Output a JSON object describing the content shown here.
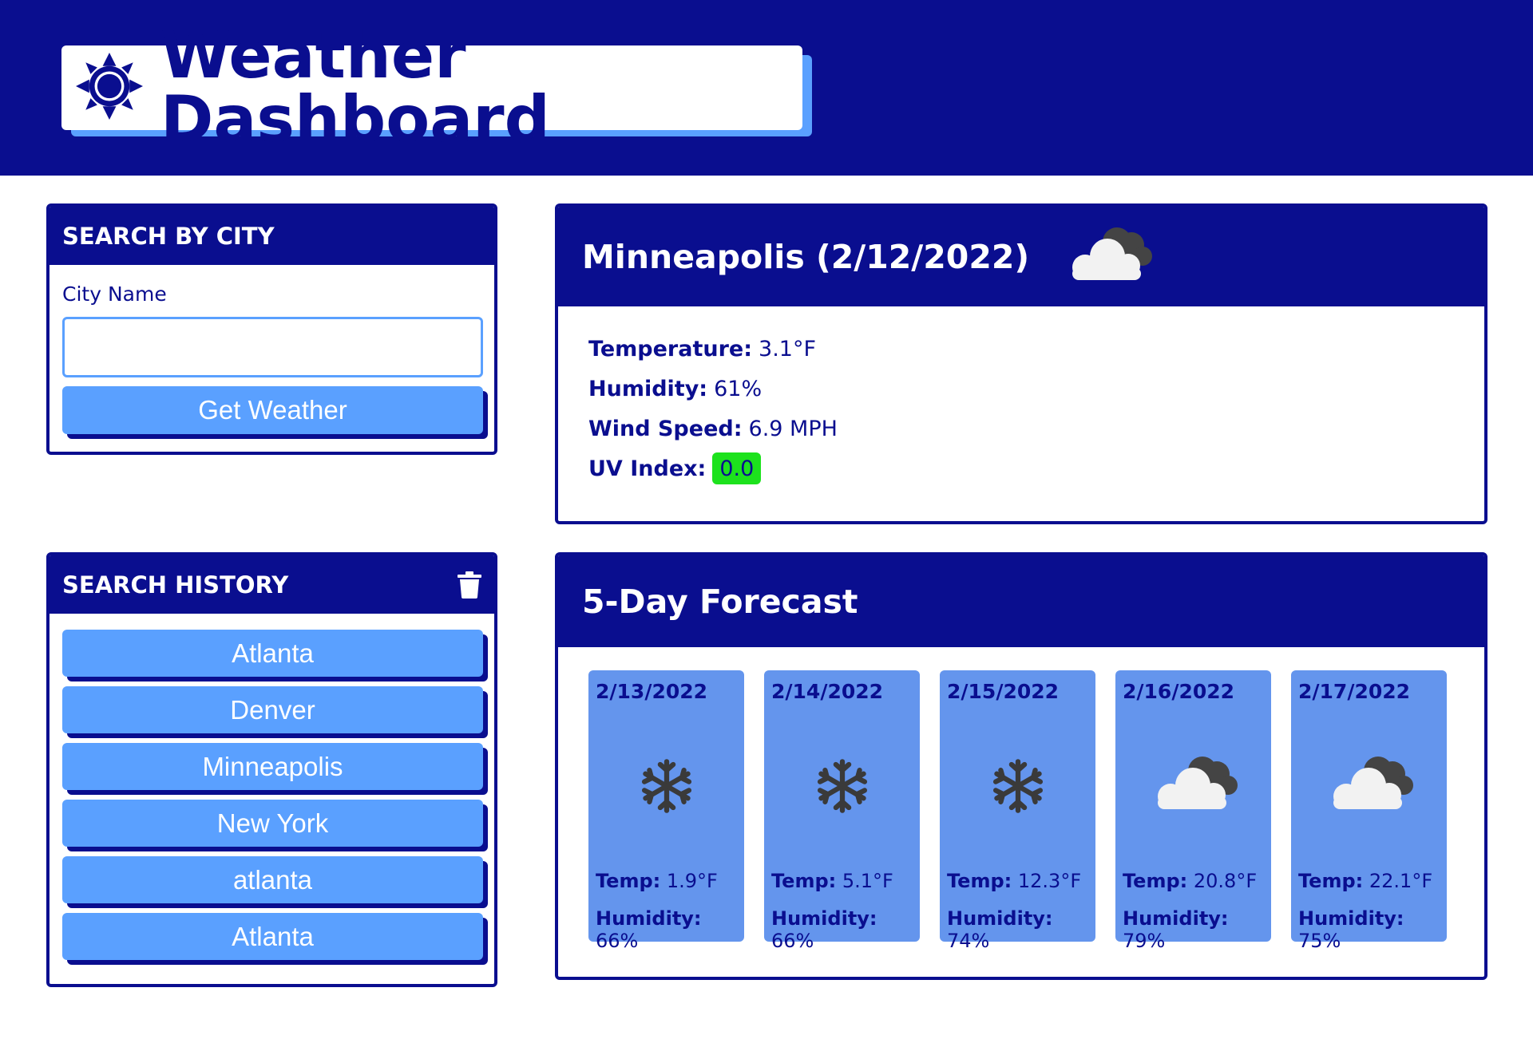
{
  "header": {
    "title": "Weather Dashboard",
    "icon": "sun-icon"
  },
  "search": {
    "heading": "SEARCH BY CITY",
    "label": "City Name",
    "value": "",
    "placeholder": "",
    "button": "Get Weather"
  },
  "history": {
    "heading": "SEARCH HISTORY",
    "clear_icon": "trash-icon",
    "items": [
      "Atlanta",
      "Denver",
      "Minneapolis",
      "New York",
      "atlanta",
      "Atlanta"
    ]
  },
  "current": {
    "heading": "Minneapolis (2/12/2022)",
    "icon": "cloudy-icon",
    "temperature_label": "Temperature:",
    "temperature": "3.1°F",
    "humidity_label": "Humidity:",
    "humidity": "61%",
    "wind_label": "Wind Speed:",
    "wind": "6.9 MPH",
    "uv_label": "UV Index:",
    "uv": "0.0",
    "uv_color": "#1de21d"
  },
  "forecast": {
    "heading": "5-Day Forecast",
    "temp_label": "Temp:",
    "humidity_label": "Humidity:",
    "days": [
      {
        "date": "2/13/2022",
        "icon": "snowflake-icon",
        "temp": "1.9°F",
        "humidity": "66%"
      },
      {
        "date": "2/14/2022",
        "icon": "snowflake-icon",
        "temp": "5.1°F",
        "humidity": "66%"
      },
      {
        "date": "2/15/2022",
        "icon": "snowflake-icon",
        "temp": "12.3°F",
        "humidity": "74%"
      },
      {
        "date": "2/16/2022",
        "icon": "cloudy-icon",
        "temp": "20.8°F",
        "humidity": "79%"
      },
      {
        "date": "2/17/2022",
        "icon": "cloudy-icon",
        "temp": "22.1°F",
        "humidity": "75%"
      }
    ]
  },
  "colors": {
    "navy": "#0a0e8f",
    "button": "#5aa0ff",
    "forecast_card": "#6495ed"
  }
}
